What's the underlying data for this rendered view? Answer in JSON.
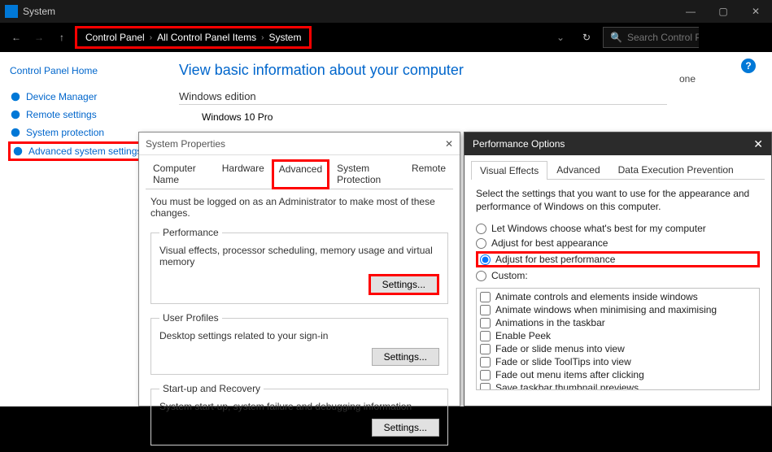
{
  "titlebar": {
    "title": "System"
  },
  "breadcrumb": {
    "p0": "Control Panel",
    "p1": "All Control Panel Items",
    "p2": "System"
  },
  "search": {
    "placeholder": "Search Control Panel"
  },
  "sidebar": {
    "home": "Control Panel Home",
    "links": {
      "device_manager": "Device Manager",
      "remote": "Remote settings",
      "sysprot": "System protection",
      "adv": "Advanced system settings"
    }
  },
  "content": {
    "heading": "View basic information about your computer",
    "section": "Windows edition",
    "edition": "Windows 10 Pro"
  },
  "right_label": "one",
  "sysprops": {
    "title": "System Properties",
    "tabs": {
      "t0": "Computer Name",
      "t1": "Hardware",
      "t2": "Advanced",
      "t3": "System Protection",
      "t4": "Remote"
    },
    "note": "You must be logged on as an Administrator to make most of these changes.",
    "perf": {
      "legend": "Performance",
      "desc": "Visual effects, processor scheduling, memory usage and virtual memory",
      "btn": "Settings..."
    },
    "profiles": {
      "legend": "User Profiles",
      "desc": "Desktop settings related to your sign-in",
      "btn": "Settings..."
    },
    "startup": {
      "legend": "Start-up and Recovery",
      "desc": "System start-up, system failure and debugging information",
      "btn": "Settings..."
    }
  },
  "perfopts": {
    "title": "Performance Options",
    "tabs": {
      "t0": "Visual Effects",
      "t1": "Advanced",
      "t2": "Data Execution Prevention"
    },
    "desc": "Select the settings that you want to use for the appearance and performance of Windows on this computer.",
    "radios": {
      "r0": "Let Windows choose what's best for my computer",
      "r1": "Adjust for best appearance",
      "r2": "Adjust for best performance",
      "r3": "Custom:"
    },
    "checks": {
      "c0": "Animate controls and elements inside windows",
      "c1": "Animate windows when minimising and maximising",
      "c2": "Animations in the taskbar",
      "c3": "Enable Peek",
      "c4": "Fade or slide menus into view",
      "c5": "Fade or slide ToolTips into view",
      "c6": "Fade out menu items after clicking",
      "c7": "Save taskbar thumbnail previews"
    }
  }
}
